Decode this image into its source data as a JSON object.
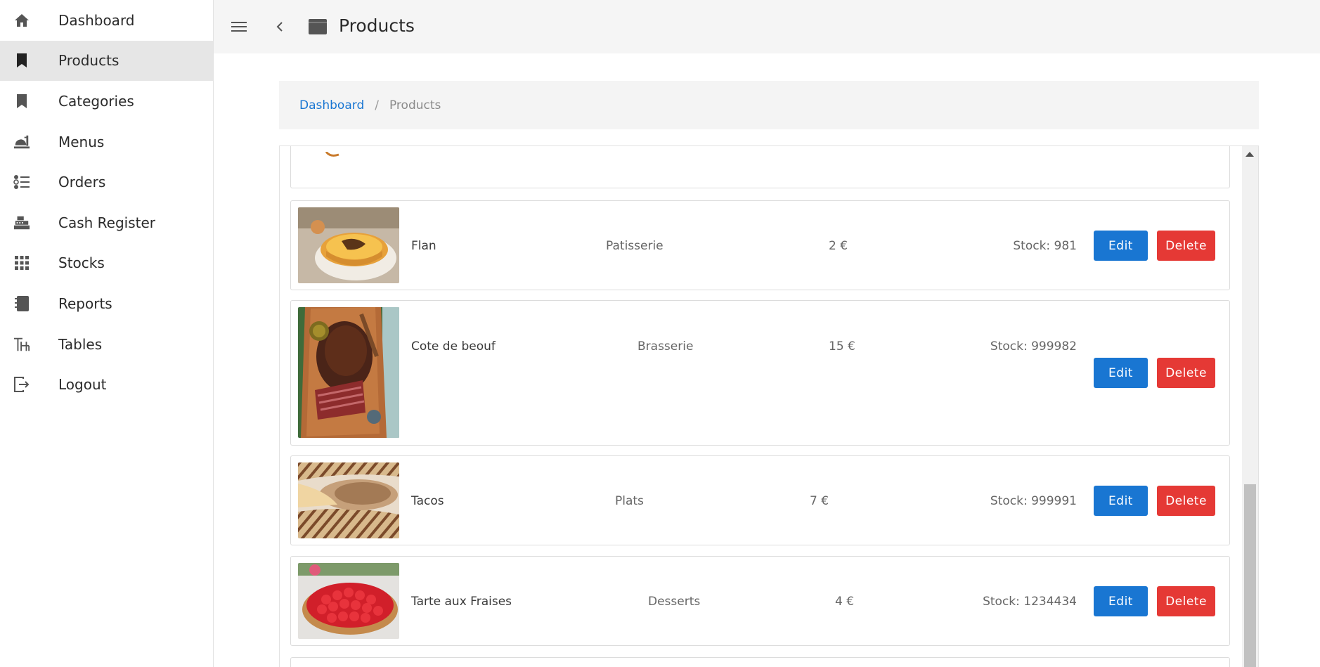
{
  "sidebar": {
    "items": [
      {
        "label": "Dashboard",
        "icon": "home-icon",
        "active": false
      },
      {
        "label": "Products",
        "icon": "bookmark-icon",
        "active": true
      },
      {
        "label": "Categories",
        "icon": "bookmark-icon",
        "active": false
      },
      {
        "label": "Menus",
        "icon": "room-service-icon",
        "active": false
      },
      {
        "label": "Orders",
        "icon": "list-icon",
        "active": false
      },
      {
        "label": "Cash Register",
        "icon": "cash-register-icon",
        "active": false
      },
      {
        "label": "Stocks",
        "icon": "grid-icon",
        "active": false
      },
      {
        "label": "Reports",
        "icon": "notebook-icon",
        "active": false
      },
      {
        "label": "Tables",
        "icon": "table-icon",
        "active": false
      },
      {
        "label": "Logout",
        "icon": "logout-icon",
        "active": false
      }
    ]
  },
  "header": {
    "title": "Products",
    "menu_icon": "hamburger-menu-icon",
    "back_icon": "chevron-left-icon",
    "page_icon": "window-icon"
  },
  "breadcrumb": {
    "root": "Dashboard",
    "separator": "/",
    "current": "Products"
  },
  "products": [
    {
      "name": "Flan",
      "category": "Patisserie",
      "price": "2 €",
      "stock": "Stock: 981",
      "edit": "Edit",
      "delete": "Delete"
    },
    {
      "name": "Cote de beouf",
      "category": "Brasserie",
      "price": "15 €",
      "stock": "Stock: 999982",
      "edit": "Edit",
      "delete": "Delete"
    },
    {
      "name": "Tacos",
      "category": "Plats",
      "price": "7 €",
      "stock": "Stock: 999991",
      "edit": "Edit",
      "delete": "Delete"
    },
    {
      "name": "Tarte aux Fraises",
      "category": "Desserts",
      "price": "4 €",
      "stock": "Stock: 1234434",
      "edit": "Edit",
      "delete": "Delete"
    }
  ],
  "colors": {
    "accent": "#1976d2",
    "danger": "#e53935",
    "active_nav": "#e6e6e6"
  }
}
